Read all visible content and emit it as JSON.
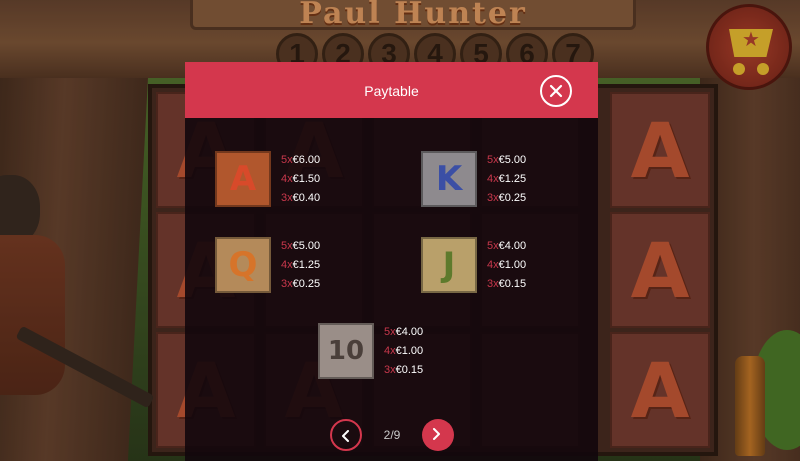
{
  "game": {
    "title": "Paul Hunter",
    "lines": [
      "1",
      "2",
      "3",
      "4",
      "5",
      "6",
      "7"
    ],
    "reels": [
      [
        "A",
        "A",
        "A"
      ],
      [
        "A",
        "",
        "A"
      ],
      [
        "",
        "",
        ""
      ],
      [
        "",
        "",
        ""
      ],
      [
        "",
        "",
        ""
      ],
      [
        "A",
        "A",
        "A"
      ]
    ]
  },
  "paytable": {
    "title": "Paytable",
    "entries": [
      {
        "symbol": "A",
        "tile_color": "#b1572d",
        "glyph_color": "#d84a2a",
        "pays": [
          {
            "mult": "5x",
            "amt": "€6.00"
          },
          {
            "mult": "4x",
            "amt": "€1.50"
          },
          {
            "mult": "3x",
            "amt": "€0.40"
          }
        ]
      },
      {
        "symbol": "K",
        "tile_color": "#8e8a8e",
        "glyph_color": "#3b4fa5",
        "pays": [
          {
            "mult": "5x",
            "amt": "€5.00"
          },
          {
            "mult": "4x",
            "amt": "€1.25"
          },
          {
            "mult": "3x",
            "amt": "€0.25"
          }
        ]
      },
      {
        "symbol": "Q",
        "tile_color": "#b48a5a",
        "glyph_color": "#d6742a",
        "pays": [
          {
            "mult": "5x",
            "amt": "€5.00"
          },
          {
            "mult": "4x",
            "amt": "€1.25"
          },
          {
            "mult": "3x",
            "amt": "€0.25"
          }
        ]
      },
      {
        "symbol": "J",
        "tile_color": "#b9a06a",
        "glyph_color": "#5e7a2c",
        "pays": [
          {
            "mult": "5x",
            "amt": "€4.00"
          },
          {
            "mult": "4x",
            "amt": "€1.00"
          },
          {
            "mult": "3x",
            "amt": "€0.15"
          }
        ]
      },
      {
        "symbol": "10",
        "tile_color": "#9a8e88",
        "glyph_color": "#4a3f3a",
        "pays": [
          {
            "mult": "5x",
            "amt": "€4.00"
          },
          {
            "mult": "4x",
            "amt": "€1.00"
          },
          {
            "mult": "3x",
            "amt": "€0.15"
          }
        ]
      }
    ],
    "page_indicator": "2/9"
  },
  "icons": {
    "close": "close-icon",
    "prev": "chevron-left-icon",
    "next": "chevron-right-icon",
    "cart": "shop-cart-icon"
  },
  "colors": {
    "accent": "#d4374d"
  }
}
